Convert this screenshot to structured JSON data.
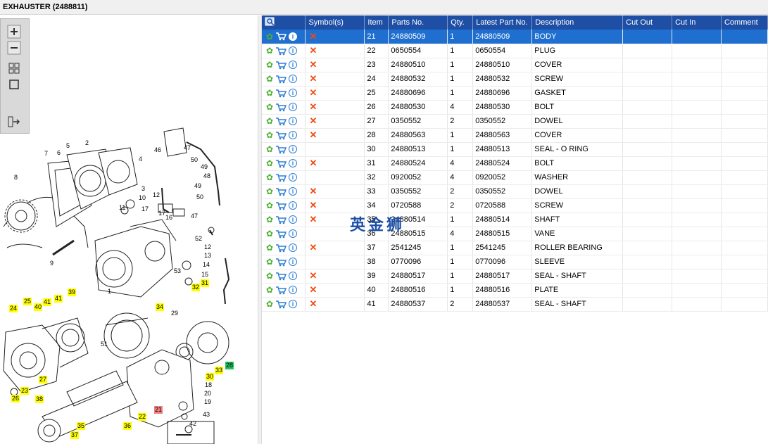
{
  "window": {
    "title": "EXHAUSTER (2488811)"
  },
  "toolbox": {
    "tools": [
      "zoom-in-icon",
      "zoom-out-icon",
      "fit-all-icon",
      "fit-window-icon",
      "export-icon"
    ]
  },
  "diagram": {
    "callouts": [
      {
        "label": "8"
      },
      {
        "label": "7"
      },
      {
        "label": "5"
      },
      {
        "label": "2"
      },
      {
        "label": "6"
      },
      {
        "label": "4"
      },
      {
        "label": "46"
      },
      {
        "label": "47"
      },
      {
        "label": "50"
      },
      {
        "label": "49"
      },
      {
        "label": "48"
      },
      {
        "label": "49"
      },
      {
        "label": "50"
      },
      {
        "label": "3"
      },
      {
        "label": "10"
      },
      {
        "label": "11"
      },
      {
        "label": "17"
      },
      {
        "label": "12"
      },
      {
        "label": "17"
      },
      {
        "label": "16"
      },
      {
        "label": "47"
      },
      {
        "label": "9"
      },
      {
        "label": "52"
      },
      {
        "label": "12"
      },
      {
        "label": "13"
      },
      {
        "label": "14"
      },
      {
        "label": "53"
      },
      {
        "label": "15"
      },
      {
        "label": "1"
      },
      {
        "label": "32"
      },
      {
        "label": "31"
      },
      {
        "label": "39"
      },
      {
        "label": "24"
      },
      {
        "label": "25"
      },
      {
        "label": "40"
      },
      {
        "label": "41"
      },
      {
        "label": "41"
      },
      {
        "label": "34"
      },
      {
        "label": "29"
      },
      {
        "label": "51"
      },
      {
        "label": "28"
      },
      {
        "label": "33"
      },
      {
        "label": "30"
      },
      {
        "label": "18"
      },
      {
        "label": "20"
      },
      {
        "label": "19"
      },
      {
        "label": "27"
      },
      {
        "label": "23"
      },
      {
        "label": "26"
      },
      {
        "label": "38"
      },
      {
        "label": "22"
      },
      {
        "label": "21"
      },
      {
        "label": "36"
      },
      {
        "label": "35"
      },
      {
        "label": "37"
      },
      {
        "label": "43"
      },
      {
        "label": "42"
      }
    ]
  },
  "grid": {
    "columns": [
      "",
      "Symbol(s)",
      "Item",
      "Parts No.",
      "Qty.",
      "Latest Part No.",
      "Description",
      "Cut Out",
      "Cut In",
      "Comment"
    ],
    "rows": [
      {
        "item": "21",
        "part": "24880509",
        "qty": "1",
        "latest": "24880509",
        "desc": "BODY",
        "x": "✕",
        "selected": true
      },
      {
        "item": "22",
        "part": "0650554",
        "qty": "1",
        "latest": "0650554",
        "desc": "PLUG",
        "x": "✕"
      },
      {
        "item": "23",
        "part": "24880510",
        "qty": "1",
        "latest": "24880510",
        "desc": "COVER",
        "x": "✕"
      },
      {
        "item": "24",
        "part": "24880532",
        "qty": "1",
        "latest": "24880532",
        "desc": "SCREW",
        "x": "✕"
      },
      {
        "item": "25",
        "part": "24880696",
        "qty": "1",
        "latest": "24880696",
        "desc": "GASKET",
        "x": "✕"
      },
      {
        "item": "26",
        "part": "24880530",
        "qty": "4",
        "latest": "24880530",
        "desc": "BOLT",
        "x": "✕"
      },
      {
        "item": "27",
        "part": "0350552",
        "qty": "2",
        "latest": "0350552",
        "desc": "DOWEL",
        "x": "✕"
      },
      {
        "item": "28",
        "part": "24880563",
        "qty": "1",
        "latest": "24880563",
        "desc": "COVER",
        "x": "✕"
      },
      {
        "item": "30",
        "part": "24880513",
        "qty": "1",
        "latest": "24880513",
        "desc": "SEAL - O RING",
        "x": ""
      },
      {
        "item": "31",
        "part": "24880524",
        "qty": "4",
        "latest": "24880524",
        "desc": "BOLT",
        "x": "✕"
      },
      {
        "item": "32",
        "part": "0920052",
        "qty": "4",
        "latest": "0920052",
        "desc": "WASHER",
        "x": ""
      },
      {
        "item": "33",
        "part": "0350552",
        "qty": "2",
        "latest": "0350552",
        "desc": "DOWEL",
        "x": "✕"
      },
      {
        "item": "34",
        "part": "0720588",
        "qty": "2",
        "latest": "0720588",
        "desc": "SCREW",
        "x": "✕"
      },
      {
        "item": "35",
        "part": "24880514",
        "qty": "1",
        "latest": "24880514",
        "desc": "SHAFT",
        "x": "✕"
      },
      {
        "item": "36",
        "part": "24880515",
        "qty": "4",
        "latest": "24880515",
        "desc": "VANE",
        "x": ""
      },
      {
        "item": "37",
        "part": "2541245",
        "qty": "1",
        "latest": "2541245",
        "desc": "ROLLER BEARING",
        "x": "✕"
      },
      {
        "item": "38",
        "part": "0770096",
        "qty": "1",
        "latest": "0770096",
        "desc": "SLEEVE",
        "x": ""
      },
      {
        "item": "39",
        "part": "24880517",
        "qty": "1",
        "latest": "24880517",
        "desc": "SEAL - SHAFT",
        "x": "✕"
      },
      {
        "item": "40",
        "part": "24880516",
        "qty": "1",
        "latest": "24880516",
        "desc": "PLATE",
        "x": "✕"
      },
      {
        "item": "41",
        "part": "24880537",
        "qty": "2",
        "latest": "24880537",
        "desc": "SEAL - SHAFT",
        "x": "✕"
      }
    ]
  },
  "watermark": {
    "text": "英金狮"
  },
  "colors": {
    "header": "#1e4fa5",
    "selected_row": "#1f6fd0",
    "highlight_yellow": "#ffff00",
    "highlight_green": "#22c55e",
    "highlight_red": "#f07f7f",
    "remove_mark": "#f04a12"
  }
}
